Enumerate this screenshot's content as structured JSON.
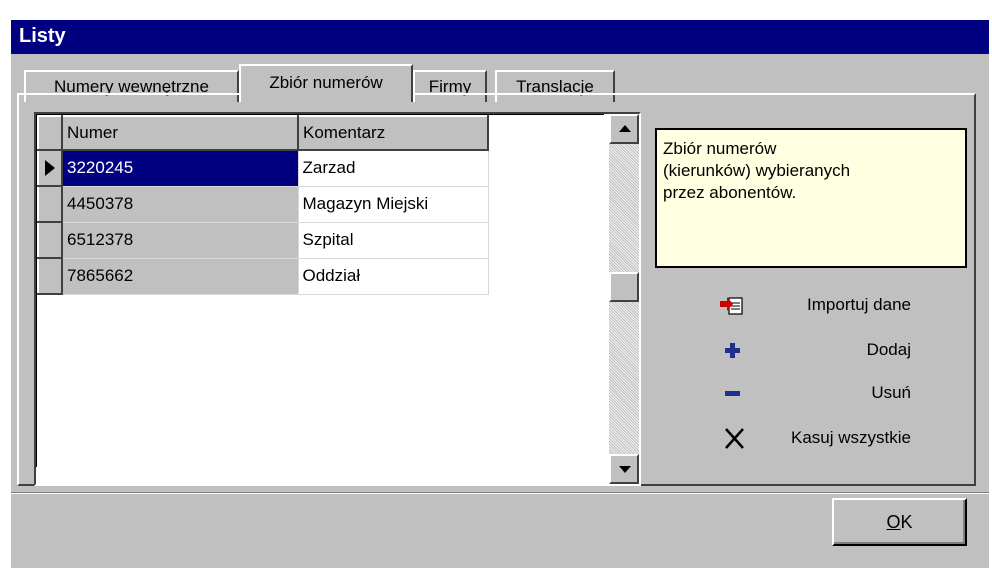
{
  "window": {
    "title": "Listy"
  },
  "tabs": [
    {
      "label": "Numery wewnętrzne",
      "active": false
    },
    {
      "label": "Zbiór numerów",
      "active": true
    },
    {
      "label": "Firmy",
      "active": false
    },
    {
      "label": "Translacje",
      "active": false
    }
  ],
  "grid": {
    "columns": [
      "Numer",
      "Komentarz"
    ],
    "rows": [
      {
        "numer": "3220245",
        "komentarz": "Zarzad",
        "selected": true
      },
      {
        "numer": "4450378",
        "komentarz": "Magazyn Miejski",
        "selected": false
      },
      {
        "numer": "6512378",
        "komentarz": "Szpital",
        "selected": false
      },
      {
        "numer": "7865662",
        "komentarz": "Oddział",
        "selected": false
      }
    ]
  },
  "info": {
    "text_lines": [
      "Zbiór numerów",
      "(kierunków) wybieranych",
      "przez abonentów."
    ]
  },
  "actions": {
    "import_label": "Importuj dane",
    "add_label": "Dodaj",
    "remove_label": "Usuń",
    "clear_all_label": "Kasuj wszystkie"
  },
  "ok_button": {
    "label_underlined": "O",
    "label_rest": "K"
  },
  "colors": {
    "title_bar": "#000080",
    "window_face": "#c0c0c0",
    "selection": "#000080",
    "info_background": "#ffffe1",
    "add_icon": "#1f2f8f",
    "import_icon": "#cc0000"
  },
  "icons": {
    "import": "import-data-icon",
    "add": "plus-icon",
    "remove": "minus-icon",
    "clear": "x-icon"
  }
}
